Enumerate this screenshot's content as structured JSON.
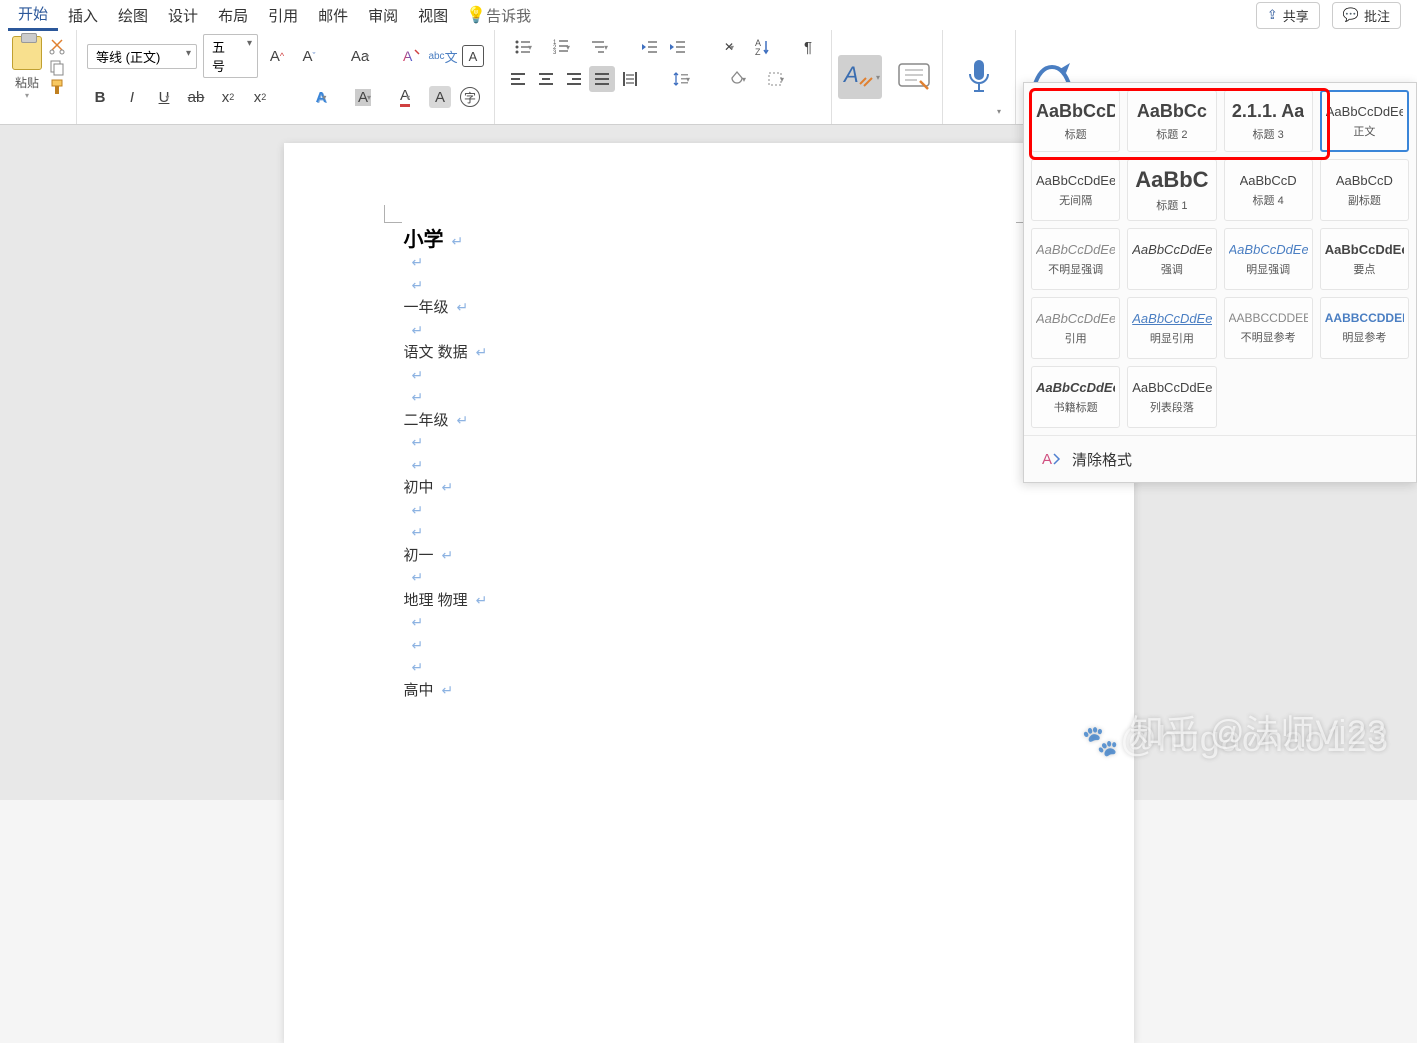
{
  "tabs": [
    "开始",
    "插入",
    "绘图",
    "设计",
    "布局",
    "引用",
    "邮件",
    "审阅",
    "视图"
  ],
  "tell_me": "告诉我",
  "share": "共享",
  "comments": "批注",
  "clipboard": {
    "paste": "粘贴"
  },
  "font": {
    "name": "等线 (正文)",
    "size": "五号"
  },
  "doc": {
    "title": "小学",
    "lines": [
      "一年级",
      "",
      "语文 数据",
      "",
      "",
      "二年级",
      "",
      "",
      "初中",
      "",
      "",
      "初一",
      "",
      "地理 物理",
      "",
      "",
      "",
      "高中"
    ]
  },
  "styles": [
    {
      "preview": "AaBbCcD",
      "name": "标题",
      "big": true,
      "sel": false
    },
    {
      "preview": "AaBbCc",
      "name": "标题 2",
      "big": true,
      "sel": false
    },
    {
      "preview": "2.1.1. Aa",
      "name": "标题 3",
      "big": true,
      "sel": false
    },
    {
      "preview": "AaBbCcDdEe",
      "name": "正文",
      "sel": true
    },
    {
      "preview": "AaBbCcDdEe",
      "name": "无间隔"
    },
    {
      "preview": "AaBbC",
      "name": "标题 1",
      "big2": true
    },
    {
      "preview": "AaBbCcD",
      "name": "标题 4"
    },
    {
      "preview": "AaBbCcD",
      "name": "副标题"
    },
    {
      "preview": "AaBbCcDdEe",
      "name": "不明显强调",
      "italic": true,
      "color": "#888"
    },
    {
      "preview": "AaBbCcDdEe",
      "name": "强调",
      "italic": true
    },
    {
      "preview": "AaBbCcDdEe",
      "name": "明显强调",
      "italic": true,
      "color": "#4a7ec2"
    },
    {
      "preview": "AaBbCcDdEe",
      "name": "要点",
      "bold": true
    },
    {
      "preview": "AaBbCcDdEe",
      "name": "引用",
      "italic": true,
      "color": "#888"
    },
    {
      "preview": "AaBbCcDdEe",
      "name": "明显引用",
      "italic": true,
      "color": "#4a7ec2",
      "under": true
    },
    {
      "preview": "AABBCCDDEE",
      "name": "不明显参考",
      "sc": true,
      "color": "#888"
    },
    {
      "preview": "AABBCCDDEE",
      "name": "明显参考",
      "sc": true,
      "color": "#4a7ec2",
      "bold": true
    },
    {
      "preview": "AaBbCcDdEe",
      "name": "书籍标题",
      "italic": true,
      "bold": true
    },
    {
      "preview": "AaBbCcDdEe",
      "name": "列表段落"
    }
  ],
  "clear_format": "清除格式",
  "watermark": "知乎 @法师Vi23",
  "watermark2": "@hugaohao123"
}
